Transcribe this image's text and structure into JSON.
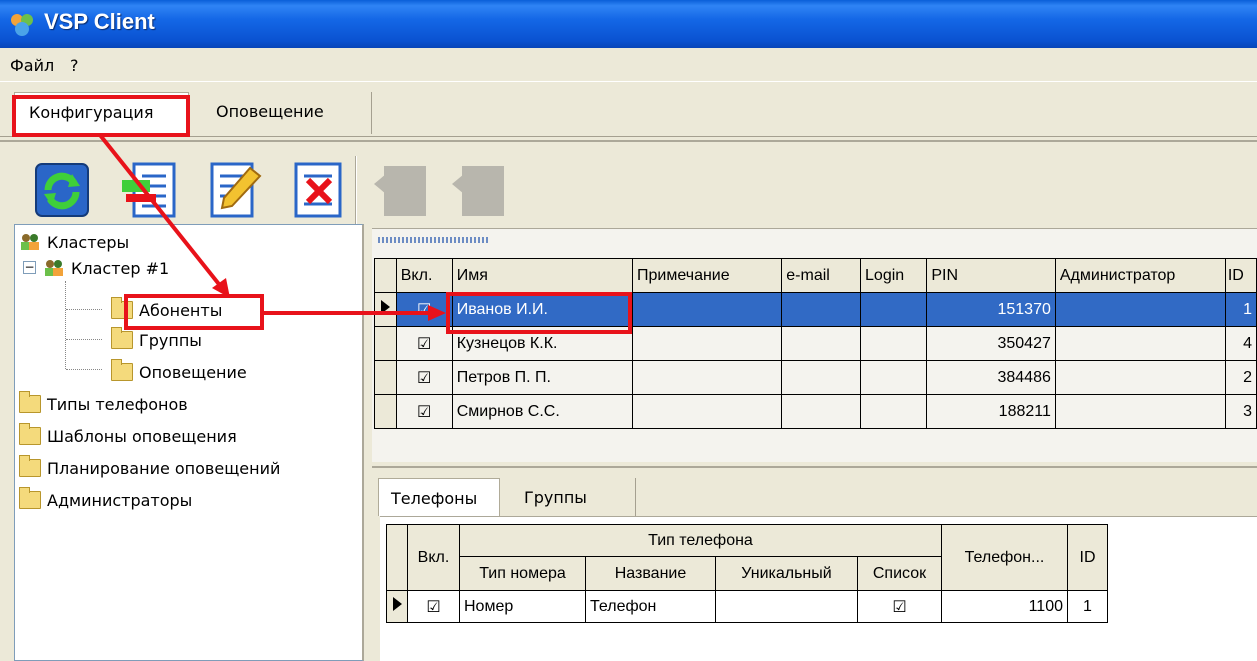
{
  "window": {
    "title": "VSP Client",
    "app_icon": "app-logo-icon"
  },
  "menu": {
    "items": [
      "Файл",
      "?"
    ]
  },
  "top_tabs": [
    "Конфигурация",
    "Оповещение"
  ],
  "toolbar": {
    "buttons": [
      "refresh-icon",
      "add-record-icon",
      "edit-record-icon",
      "delete-record-icon",
      "disabled-action-icon",
      "disabled-action-icon"
    ]
  },
  "tree": {
    "root": "Кластеры",
    "cluster": "Кластер #1",
    "cluster_children": [
      "Абоненты",
      "Группы",
      "Оповещение"
    ],
    "top_items": [
      "Типы телефонов",
      "Шаблоны оповещения",
      "Планирование оповещений",
      "Администраторы"
    ]
  },
  "grid": {
    "columns": [
      "Вкл.",
      "Имя",
      "Примечание",
      "e-mail",
      "Login",
      "PIN",
      "Администратор",
      "ID"
    ],
    "rows": [
      {
        "enabled": "☑",
        "name": "Иванов И.И.",
        "note": "",
        "email": "",
        "login": "",
        "pin": "151370",
        "admin": "",
        "id": "1"
      },
      {
        "enabled": "☑",
        "name": "Кузнецов К.К.",
        "note": "",
        "email": "",
        "login": "",
        "pin": "350427",
        "admin": "",
        "id": "4"
      },
      {
        "enabled": "☑",
        "name": "Петров П. П.",
        "note": "",
        "email": "",
        "login": "",
        "pin": "384486",
        "admin": "",
        "id": "2"
      },
      {
        "enabled": "☑",
        "name": "Смирнов С.С.",
        "note": "",
        "email": "",
        "login": "",
        "pin": "188211",
        "admin": "",
        "id": "3"
      }
    ]
  },
  "bottom_tabs": [
    "Телефоны",
    "Группы"
  ],
  "phones_grid": {
    "col_enabled": "Вкл.",
    "group_header": "Тип телефона",
    "sub_columns": [
      "Тип номера",
      "Название",
      "Уникальный",
      "Список"
    ],
    "col_phone": "Телефон...",
    "col_id": "ID",
    "rows": [
      {
        "enabled": "☑",
        "type": "Номер",
        "name": "Телефон",
        "unique": "",
        "list": "☑",
        "phone": "1100",
        "id": "1"
      }
    ]
  },
  "colors": {
    "selection": "#316ac5",
    "annotation": "#e8121a",
    "titlebar": "#0a52d1"
  }
}
